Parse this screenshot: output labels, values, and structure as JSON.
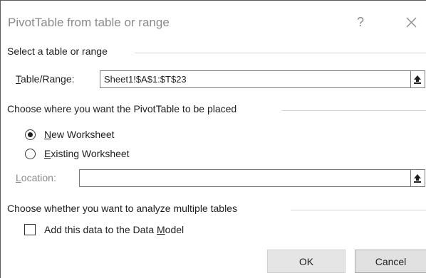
{
  "dialog": {
    "title": "PivotTable from table or range",
    "help": "?",
    "close_icon": "close-icon"
  },
  "select_section": {
    "header": "Select a table or range",
    "table_range_label_hotkey": "T",
    "table_range_label_rest": "able/Range:",
    "table_range_value": "Sheet1!$A$1:$T$23",
    "collapse_icon": "collapse-range-icon"
  },
  "placement_section": {
    "header": "Choose where you want the PivotTable to be placed",
    "options": [
      {
        "hotkey": "N",
        "rest": "ew Worksheet",
        "selected": true
      },
      {
        "hotkey": "E",
        "rest": "xisting Worksheet",
        "selected": false
      }
    ],
    "location_label_hotkey": "L",
    "location_label_rest": "ocation:",
    "location_value": "",
    "collapse_icon": "collapse-range-icon"
  },
  "multiple_section": {
    "header": "Choose whether you want to analyze multiple tables",
    "checkbox_label_before": "Add this data to the Data ",
    "checkbox_label_hotkey": "M",
    "checkbox_label_after": "odel",
    "checked": false
  },
  "buttons": {
    "ok": "OK",
    "cancel": "Cancel"
  }
}
